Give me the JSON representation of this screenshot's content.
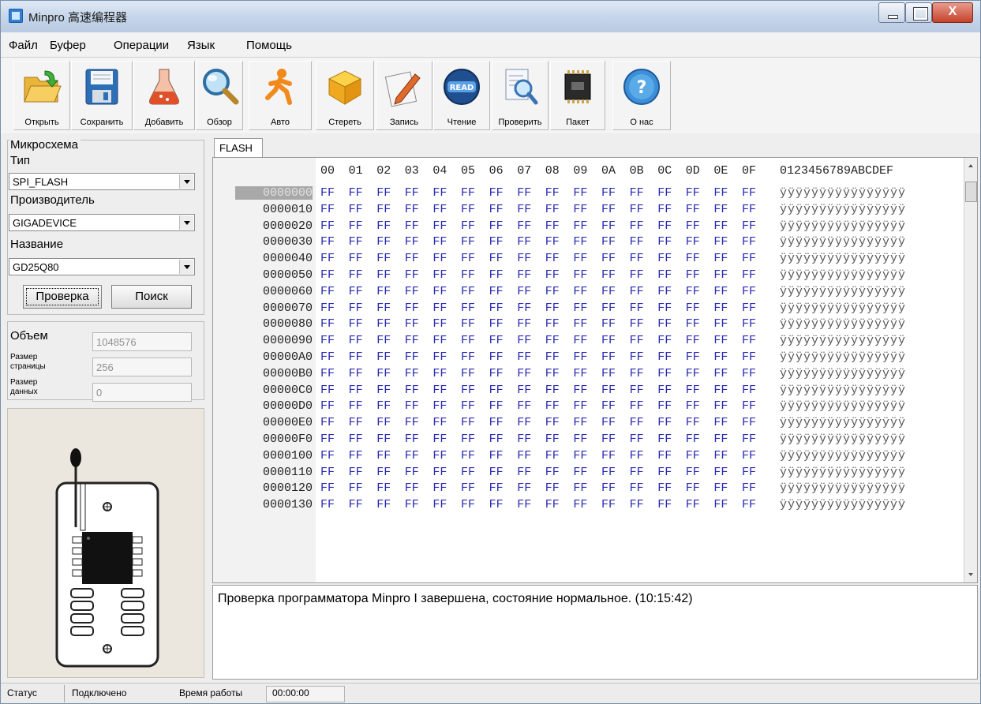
{
  "window": {
    "title": "Minpro 高速编程器",
    "close_glyph": "X"
  },
  "menu": [
    "Файл",
    "Буфер",
    "Операции",
    "Язык",
    "Помощь"
  ],
  "toolbar": [
    {
      "label": "Открыть",
      "icon": "folder-open-icon"
    },
    {
      "label": "Сохранить",
      "icon": "floppy-disk-icon"
    },
    {
      "label": "Добавить",
      "icon": "flask-icon"
    },
    {
      "label": "Обзор",
      "icon": "magnifier-icon"
    },
    {
      "label": "Авто",
      "icon": "running-man-icon"
    },
    {
      "label": "Стереть",
      "icon": "box-icon"
    },
    {
      "label": "Запись",
      "icon": "pen-paper-icon"
    },
    {
      "label": "Чтение",
      "icon": "read-disc-icon"
    },
    {
      "label": "Проверить",
      "icon": "verify-document-icon"
    },
    {
      "label": "Пакет",
      "icon": "chip-icon"
    },
    {
      "label": "О нас",
      "icon": "help-icon"
    }
  ],
  "chip": {
    "group_title": "Микросхема",
    "type_label": "Тип",
    "type_value": "SPI_FLASH",
    "vendor_label": "Производитель",
    "vendor_value": "GIGADEVICE",
    "name_label": "Название",
    "name_value": "GD25Q80",
    "check_button": "Проверка",
    "search_button": "Поиск"
  },
  "params": {
    "size_label": "Объем",
    "size_value": "1048576",
    "page_label_1": "Размер",
    "page_label_2": "страницы",
    "page_value": "256",
    "data_label_1": "Размер",
    "data_label_2": "данных",
    "data_value": "0"
  },
  "hex": {
    "tab": "FLASH",
    "col_headers": [
      "00",
      "01",
      "02",
      "03",
      "04",
      "05",
      "06",
      "07",
      "08",
      "09",
      "0A",
      "0B",
      "0C",
      "0D",
      "0E",
      "0F"
    ],
    "ascii_header": "0123456789ABCDEF",
    "rows": [
      "0000000",
      "0000010",
      "0000020",
      "0000030",
      "0000040",
      "0000050",
      "0000060",
      "0000070",
      "0000080",
      "0000090",
      "00000A0",
      "00000B0",
      "00000C0",
      "00000D0",
      "00000E0",
      "00000F0",
      "0000100",
      "0000110",
      "0000120",
      "0000130"
    ],
    "selected_row": "0000000",
    "byte_value": "FF",
    "ascii_value": "ÿÿÿÿÿÿÿÿÿÿÿÿÿÿÿÿ"
  },
  "log": "Проверка программатора Minpro I завершена, состояние нормальное. (10:15:42)",
  "status": {
    "status_label": "Статус",
    "status_value": "Подключено",
    "time_label": "Время работы",
    "time_value": "00:00:00"
  }
}
